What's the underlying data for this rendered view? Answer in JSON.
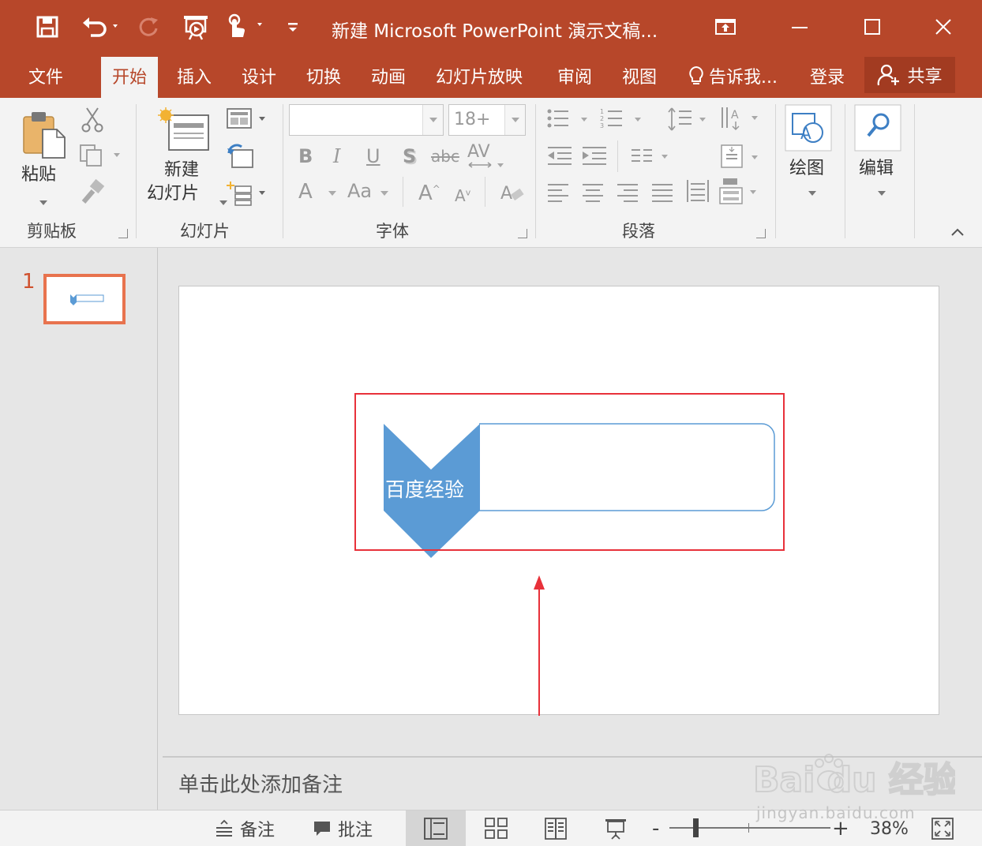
{
  "colors": {
    "accent": "#b7472a",
    "ribbon_bg": "#f3f3f3",
    "shape_fill": "#5b9bd5",
    "highlight_red": "#e8313a"
  },
  "titlebar": {
    "title": "新建 Microsoft PowerPoint 演示文稿...",
    "icons": [
      "save-icon",
      "undo-icon",
      "redo-icon",
      "start-from-beginning-icon",
      "touch-mode-icon",
      "customize-qat-icon",
      "ribbon-display-options-icon",
      "minimize-icon",
      "maximize-icon",
      "close-icon"
    ]
  },
  "tabs": {
    "file": "文件",
    "home": "开始",
    "insert": "插入",
    "design": "设计",
    "transitions": "切换",
    "animations": "动画",
    "slideshow": "幻灯片放映",
    "review": "审阅",
    "view": "视图",
    "tell_me": "告诉我...",
    "login": "登录",
    "share": "共享"
  },
  "ribbon": {
    "clipboard": {
      "label": "剪贴板",
      "paste": "粘贴"
    },
    "slides": {
      "label": "幻灯片",
      "new_slide_line1": "新建",
      "new_slide_line2": "幻灯片"
    },
    "font": {
      "label": "字体",
      "font_name": "",
      "font_size": "18+"
    },
    "paragraph": {
      "label": "段落"
    },
    "drawing": {
      "label": "绘图"
    },
    "editing": {
      "label": "编辑"
    }
  },
  "slides_pane": {
    "slide_number": "1"
  },
  "slide": {
    "shape_text": "百度经验"
  },
  "notes": {
    "placeholder": "单击此处添加备注"
  },
  "statusbar": {
    "notes": "备注",
    "comments": "批注",
    "zoom_percent": "38%",
    "zoom_minus": "-",
    "zoom_plus": "+"
  },
  "watermark": {
    "text": "jingyan.baidu.com",
    "brand": "Bai  du 经验"
  }
}
